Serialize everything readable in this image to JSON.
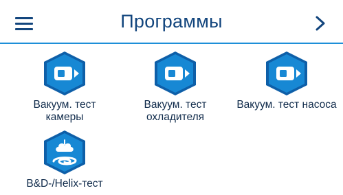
{
  "header": {
    "title": "Программы"
  },
  "programs": [
    {
      "label_line1": "Вакуум. тест",
      "label_line2": "камеры",
      "icon": "vacuum-test-icon"
    },
    {
      "label_line1": "Вакуум. тест",
      "label_line2": "охладителя",
      "icon": "vacuum-test-icon"
    },
    {
      "label_line1": "Вакуум. тест насоса",
      "label_line2": "",
      "icon": "vacuum-test-icon"
    },
    {
      "label_line1": "B&D-/Helix-тест",
      "label_line2": "",
      "icon": "bowie-dick-helix-icon"
    }
  ],
  "colors": {
    "accent": "#1d8fd8",
    "title": "#12457d",
    "hex_fill": "#1788d4",
    "hex_border": "#0e5fa8"
  }
}
